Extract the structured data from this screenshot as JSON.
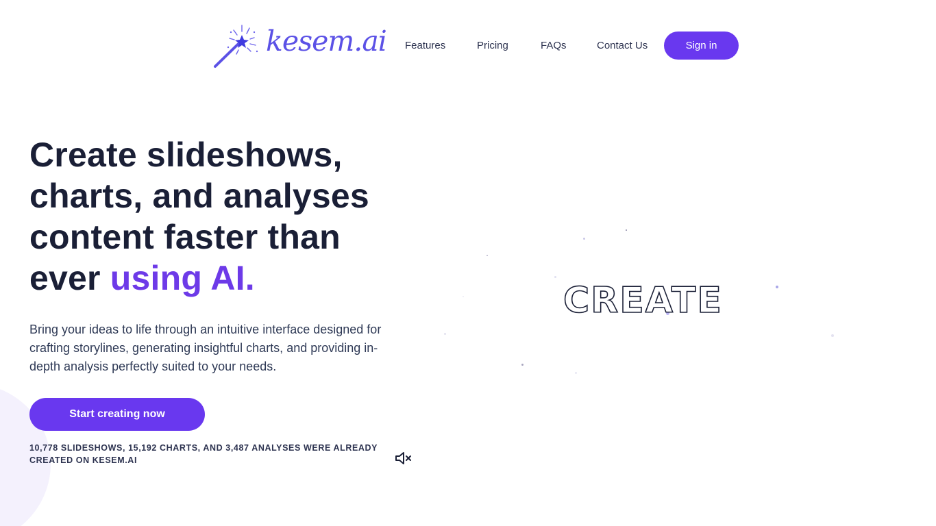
{
  "brand": {
    "name": "kesem.ai",
    "color": "#5b51e6"
  },
  "nav": {
    "links": [
      "Features",
      "Pricing",
      "FAQs",
      "Contact Us"
    ],
    "signin_label": "Sign in"
  },
  "hero": {
    "title_main": "Create slideshows, charts, and analyses content faster than ever ",
    "title_accent": "using AI.",
    "subtitle": "Bring your ideas to life through an intuitive interface designed for crafting storylines, generating insightful charts, and providing in-depth analysis perfectly suited to your needs.",
    "cta_label": "Start creating now",
    "stats_text": "10,778 slideshows, 15,192 charts, and 3,487 analyses were already created on kesem.ai"
  },
  "animation": {
    "word": "CREATE"
  },
  "icons": {
    "logo": "magic-wand-icon",
    "mute": "speaker-muted-icon"
  },
  "colors": {
    "accent": "#6938ef",
    "heading": "#1a1f36",
    "text": "#2f3a56"
  }
}
